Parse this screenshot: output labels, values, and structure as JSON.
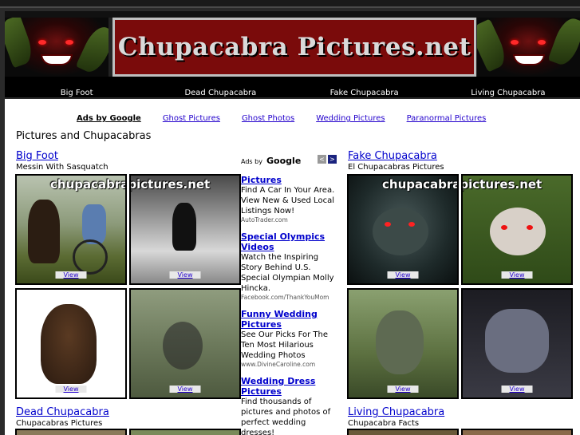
{
  "site": {
    "title": "Chupacabra Pictures.net"
  },
  "nav": [
    {
      "label": "Big Foot"
    },
    {
      "label": "Dead Chupacabra"
    },
    {
      "label": "Fake Chupacabra"
    },
    {
      "label": "Living Chupacabra"
    }
  ],
  "ad_links": {
    "ads_by": "Ads by Google",
    "items": [
      "Ghost Pictures",
      "Ghost Photos",
      "Wedding Pictures",
      "Paranormal Pictures"
    ]
  },
  "page_title": "Pictures and Chupacabras",
  "sections": [
    {
      "title": "Big Foot",
      "subtitle": "Messin With Sasquatch"
    },
    {
      "title": "Fake Chupacabra",
      "subtitle": "El Chupacabras Pictures"
    },
    {
      "title": "Dead Chupacabra",
      "subtitle": "Chupacabras Pictures"
    },
    {
      "title": "Living Chupacabra",
      "subtitle": "Chupacabra Facts"
    }
  ],
  "thumb": {
    "view_label": "View",
    "watermark": "chupacabrapictures.net"
  },
  "ad_column": {
    "ads_by": "Ads by",
    "google": "Google",
    "prev": "<",
    "next": ">",
    "ads": [
      {
        "title": "Pictures",
        "body": "Find A Car In Your Area. View New & Used Local Listings Now!",
        "url": "AutoTrader.com"
      },
      {
        "title": "Special Olympics Videos",
        "body": "Watch the Inspiring Story Behind U.S. Special Olympian Molly Hincka.",
        "url": "Facebook.com/ThankYouMom"
      },
      {
        "title": "Funny Wedding Pictures",
        "body": "See Our Picks For The Ten Most Hilarious Wedding Photos",
        "url": "www.DivineCaroline.com"
      },
      {
        "title": "Wedding Dress Pictures",
        "body": "Find thousands of pictures and photos of perfect wedding dresses!",
        "url": ""
      }
    ]
  },
  "colors": {
    "banner_red": "#7a0b0b",
    "link_blue": "#0000cc"
  }
}
